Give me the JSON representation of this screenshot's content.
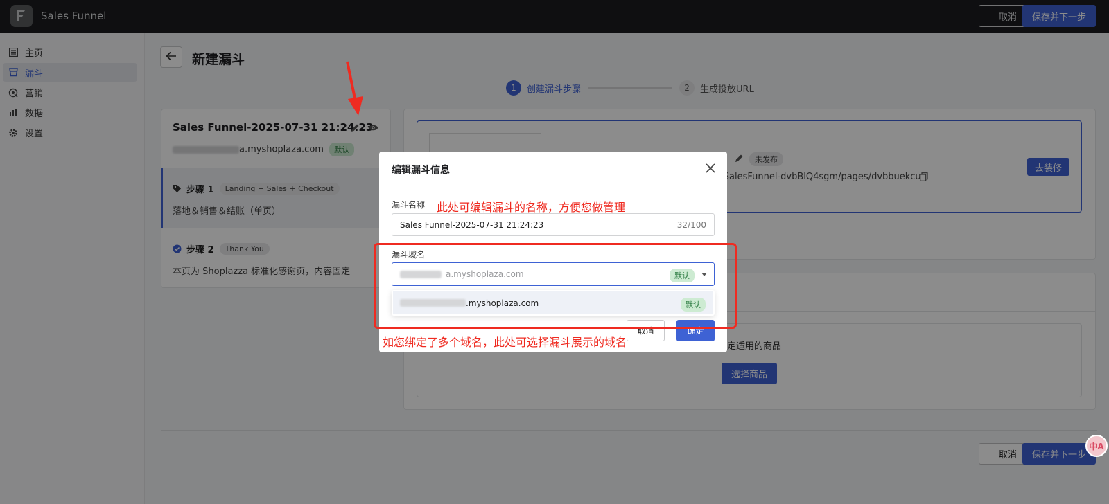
{
  "app": {
    "title": "Sales Funnel",
    "logo_icon": "brand-logo-icon"
  },
  "header": {
    "cancel_label": "取消",
    "save_next_label": "保存并下一步"
  },
  "sidebar": {
    "items": [
      {
        "label": "主页",
        "icon": "home-list-icon",
        "active": false
      },
      {
        "label": "漏斗",
        "icon": "funnel-icon",
        "active": true
      },
      {
        "label": "营销",
        "icon": "marketing-icon",
        "active": false
      },
      {
        "label": "数据",
        "icon": "bar-chart-icon",
        "active": false
      },
      {
        "label": "设置",
        "icon": "gear-icon",
        "active": false
      }
    ]
  },
  "page": {
    "title": "新建漏斗"
  },
  "stepper": {
    "steps": [
      {
        "num": "1",
        "label": "创建漏斗步骤",
        "active": true
      },
      {
        "num": "2",
        "label": "生成投放URL",
        "active": false
      }
    ]
  },
  "funnel_card": {
    "name": "Sales Funnel-2025-07-31 21:24:23",
    "domain_suffix": "a.myshoplaza.com",
    "domain_badge": "默认",
    "steps": [
      {
        "title": "步骤 1",
        "tag": "Landing + Sales + Checkout",
        "desc": "落地＆销售＆结账（单页）"
      },
      {
        "title": "步骤 2",
        "tag": "Thank You",
        "desc": "本页为 Shoplazza 标准化感谢页，内容固定"
      }
    ]
  },
  "page_card": {
    "status": "未发布",
    "url": ":/SalesFunnel-dvbBlQ4sgm/pages/dvbbuekcuq",
    "decorate_label": "去装修",
    "product_hint": "定适用的商品",
    "select_product_label": "选择商品"
  },
  "footer": {
    "cancel_label": "取消",
    "save_next_label": "保存并下一步"
  },
  "modal": {
    "title": "编辑漏斗信息",
    "name_label": "漏斗名称",
    "name_value": "Sales Funnel-2025-07-31 21:24:23",
    "name_count": "32/100",
    "domain_label": "漏斗域名",
    "domain_value": "a.myshoplaza.com",
    "domain_badge": "默认",
    "option_domain": ".myshoplaza.com",
    "option_badge": "默认",
    "cancel_label": "取消",
    "ok_label": "确定"
  },
  "annotations": {
    "name_note": "此处可编辑漏斗的名称，方便您做管理",
    "domain_note": "如您绑定了多个域名，此处可选择漏斗展示的域名",
    "color": "#ef2b21"
  },
  "floating_button": {
    "label": "中A"
  },
  "colors": {
    "primary": "#3e62d4",
    "topbar": "#1c1d20",
    "success_badge": "#cdebd2"
  }
}
